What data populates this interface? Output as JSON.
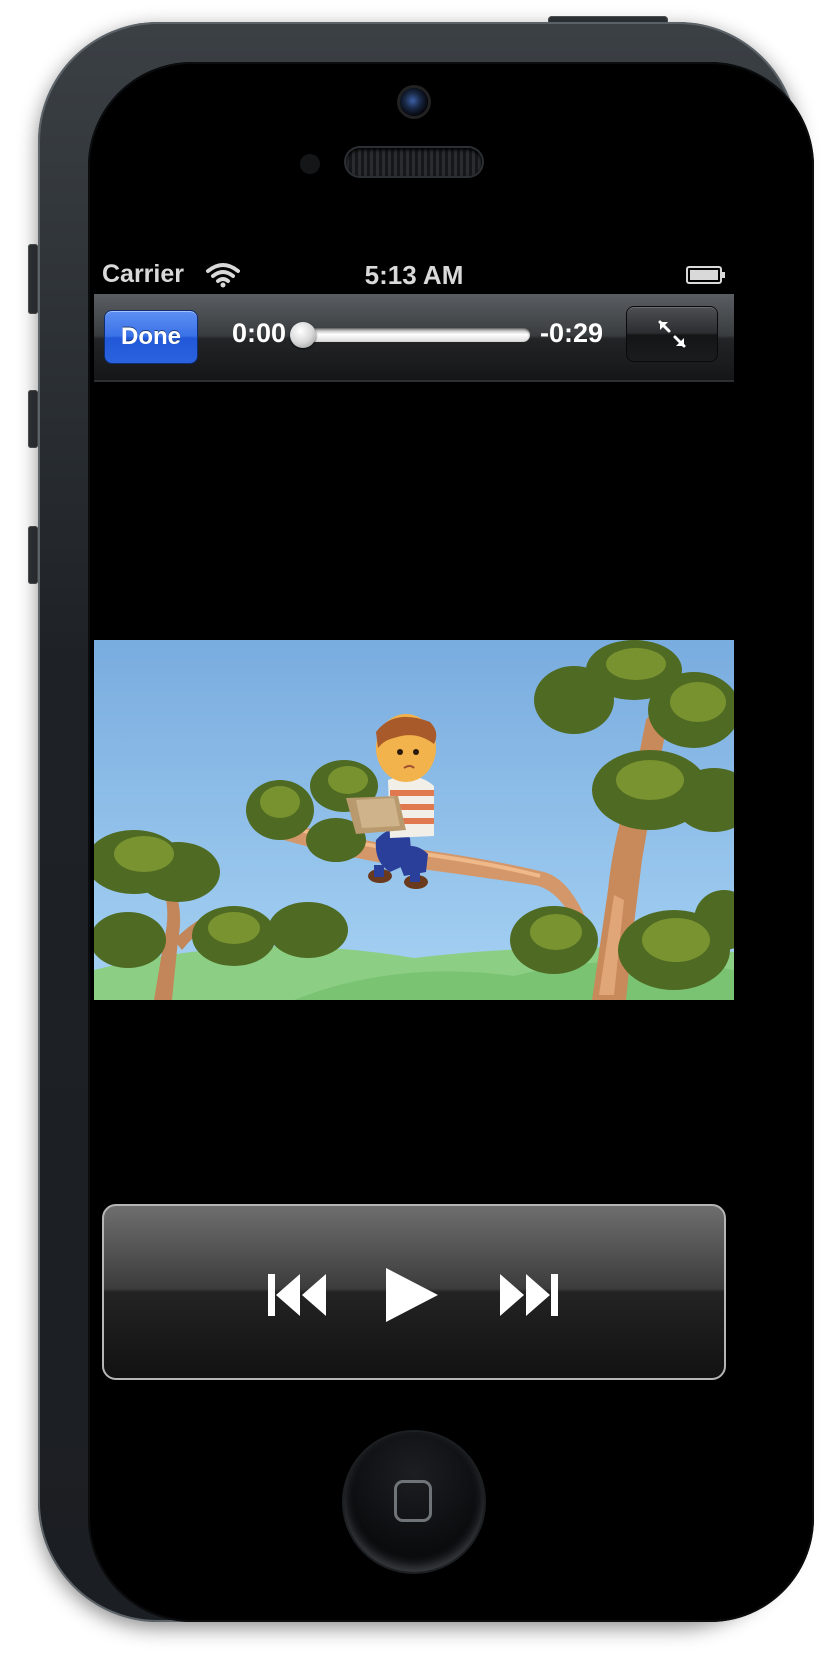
{
  "status_bar": {
    "carrier": "Carrier",
    "time": "5:13 AM",
    "wifi_icon": "wifi-icon",
    "battery_icon": "battery-icon"
  },
  "player_toolbar": {
    "done_label": "Done",
    "elapsed": "0:00",
    "remaining": "-0:29",
    "progress_fraction": 0,
    "fullscreen_icon": "expand-icon"
  },
  "transport": {
    "previous_icon": "skip-back-icon",
    "play_icon": "play-icon",
    "next_icon": "skip-forward-icon"
  },
  "colors": {
    "done_button": "#2f66e0",
    "sky": "#8fc0ec",
    "foliage": "#5c7a28"
  }
}
